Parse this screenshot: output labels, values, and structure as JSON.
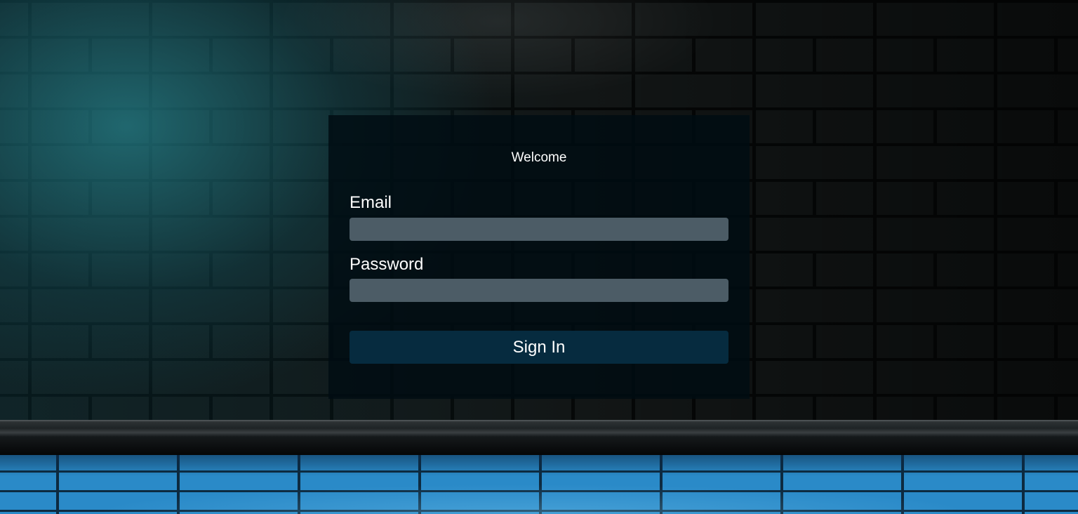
{
  "login": {
    "title": "Welcome",
    "email_label": "Email",
    "email_value": "",
    "password_label": "Password",
    "password_value": "",
    "signin_label": "Sign In"
  },
  "colors": {
    "panel_background": "#000c12",
    "input_background": "#4c5c66",
    "button_background": "#062b3f",
    "text": "#ffffff"
  }
}
